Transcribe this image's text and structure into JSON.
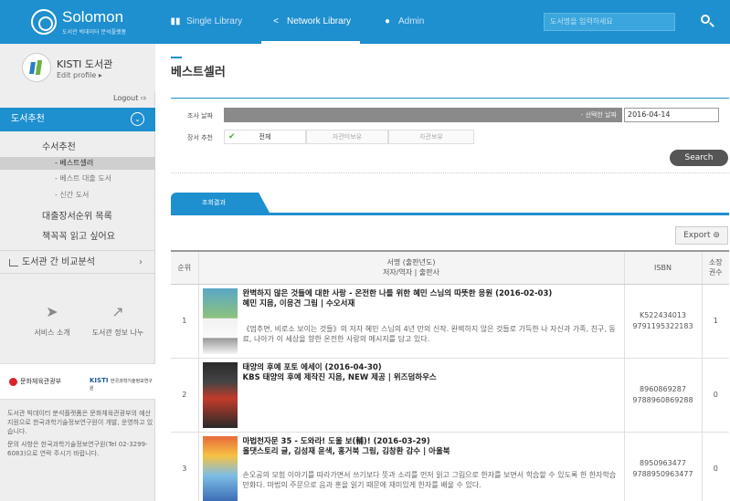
{
  "header": {
    "logo_name": "Solomon",
    "logo_sub": "도서관 빅데이터 분석플랫폼",
    "tabs": [
      {
        "label": "Single Library",
        "icon": "library-icon"
      },
      {
        "label": "Network Library",
        "icon": "share-icon"
      },
      {
        "label": "Admin",
        "icon": "user-icon"
      }
    ],
    "search_placeholder": "도서명을 입력하세요"
  },
  "sidebar": {
    "profile_name": "KISTI 도서관",
    "edit_profile": "Edit profile ▸",
    "logout": "Logout ⇨",
    "menu_head": "도서추천",
    "items": {
      "pick": "수서추천",
      "best": "- 베스트셀러",
      "best_loan": "- 베스트 대출 도서",
      "new": "- 신간 도서",
      "loan_rank": "대출장서순위 목록",
      "want_read": "책꼭꼭 읽고 싶어요"
    },
    "compare": "도서관 간 비교분석",
    "quick_service": "서비스 소개",
    "quick_share": "도서관 정보 나누",
    "sponsor1": "문화체육관광부",
    "sponsor2": "KISTI",
    "sponsor2_sub": "한국과학기술정보연구원",
    "note1": "도서관 빅데이터 분석플랫폼은 문화체육관광부의 예산 지원으로 한국과학기술정보연구원이 개발, 운영하고 있습니다.",
    "note2": "문의 사항은 한국과학기술정보연구원(Tel 02-3299-6083)으로 연락 주시기 바랍니다."
  },
  "main": {
    "title": "베스트셀러",
    "date_label": "조사 날짜",
    "date_hint": "- 선택한 날짜",
    "date_value": "2016-04-14",
    "holding_label": "장서 추천",
    "options": [
      "전체",
      "자관미보유",
      "자관보유"
    ],
    "search_label": "Search",
    "result_tab": "조회결과",
    "export_label": "Export ⊚",
    "table": {
      "headers": {
        "rank": "순위",
        "title_line1": "서명 (출판년도)",
        "title_line2": "저자/역자 | 출판사",
        "isbn": "ISBN",
        "count_line1": "소장",
        "count_line2": "권수"
      },
      "rows": [
        {
          "rank": "1",
          "title": "완벽하지 않은 것들에 대한 사랑 - 온전한 나를 위한 혜민 스님의 따뜻한 응원 (2016-02-03)",
          "author": "혜민 지음, 이응견 그림 | 수오서재",
          "desc": "《멈추면, 비로소 보이는 것들》의 저자 혜민 스님의 4년 만의 신작. 완벽하지 않은 것들로 가득한 나 자신과 가족, 친구, 동료, 나아가 이 세상을 향한 온전한 사랑의 메시지를 담고 있다.",
          "isbn1": "K522434013",
          "isbn2": "9791195322183",
          "count": "1"
        },
        {
          "rank": "2",
          "title": "태양의 후예 포토 에세이 (2016-04-30)",
          "author": "KBS 태양의 후예 제작진 지음, NEW 제공 | 위즈덤하우스",
          "desc": "",
          "isbn1": "8960869287",
          "isbn2": "9788960869288",
          "count": "0"
        },
        {
          "rank": "3",
          "title": "마법천자문 35 - 도와라! 도울 보(輔)! (2016-03-29)",
          "author": "올댓스토리 글, 김성재 윤색, 홍거북 그림, 김창환 감수 | 아울북",
          "desc": "손오공의 모험 이야기를 따라가면서 쓰기보다 뜻과 소리를 먼저 읽고 그림으로 한자를 보면서 학습할 수 있도록 한 한자학습만화다. 마법의 주문으로 음과 훈을 읽기 때문에 재미있게 한자를 배울 수 있다.",
          "isbn1": "8950963477",
          "isbn2": "9788950963477",
          "count": "0"
        }
      ]
    }
  }
}
